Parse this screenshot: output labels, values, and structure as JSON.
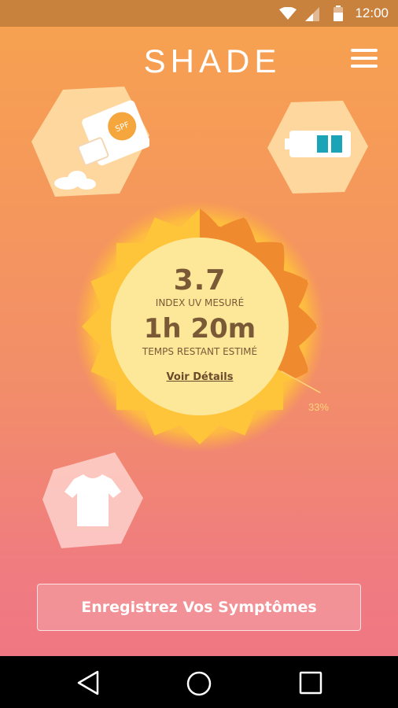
{
  "status_bar": {
    "time": "12:00",
    "icons": [
      "wifi-icon",
      "signal-icon",
      "battery-icon"
    ]
  },
  "header": {
    "brand": "SHADE",
    "menu_icon": "hamburger-menu-icon"
  },
  "widgets": {
    "sunscreen": {
      "icon": "sunscreen-icon",
      "label": "SPF"
    },
    "device_battery": {
      "icon": "device-battery-icon",
      "level": 0.5
    },
    "clothing": {
      "icon": "tshirt-icon"
    }
  },
  "uv_gauge": {
    "uv_index": "3.7",
    "uv_label": "INDEX UV MESURÉ",
    "time_remaining": "1h 20m",
    "time_label": "TEMPS RESTANT ESTIMÉ",
    "details_link": "Voir Détails",
    "exposure_percent": "33%",
    "exposure_fraction": 0.33
  },
  "actions": {
    "symptoms_button": "Enregistrez Vos Symptômes"
  },
  "nav_bar": {
    "buttons": [
      "back-icon",
      "home-icon",
      "recents-icon"
    ]
  },
  "colors": {
    "gradient_top": "#f7a24f",
    "gradient_bottom": "#ef7484",
    "sun_inner": "#fde89a",
    "sun_rays": "#ffc23a",
    "exposure_arc": "#f08a2e",
    "status_bar": "#c9823e"
  }
}
